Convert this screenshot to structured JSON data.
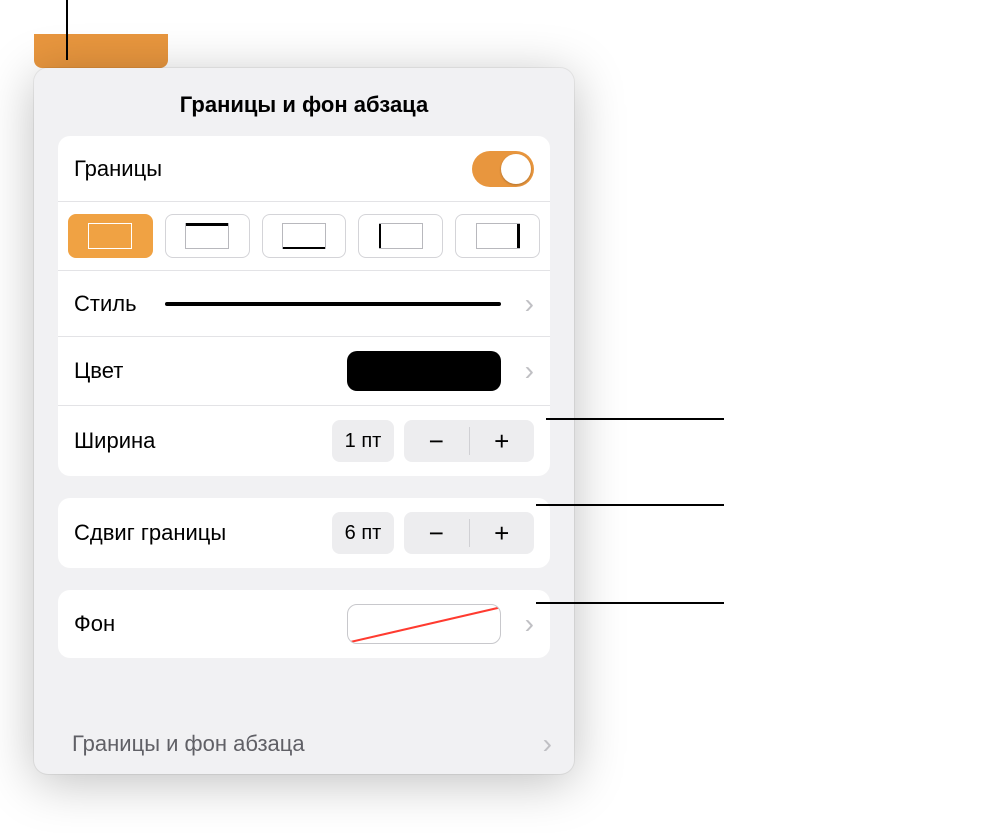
{
  "popover": {
    "title": "Границы и фон абзаца",
    "borders_label": "Границы",
    "style_label": "Стиль",
    "color_label": "Цвет",
    "width_label": "Ширина",
    "width_value": "1 пт",
    "offset_label": "Сдвиг границы",
    "offset_value": "6 пт",
    "background_label": "Фон",
    "bottom_link": "Границы и фон абзаца"
  },
  "border_positions": [
    {
      "name": "all",
      "active": true
    },
    {
      "name": "top",
      "active": false
    },
    {
      "name": "bottom",
      "active": false
    },
    {
      "name": "left",
      "active": false
    },
    {
      "name": "right",
      "active": false
    }
  ],
  "toggle_enabled": true,
  "colors": {
    "accent": "#e8963e",
    "border_color": "#000000",
    "background_color": "none"
  }
}
